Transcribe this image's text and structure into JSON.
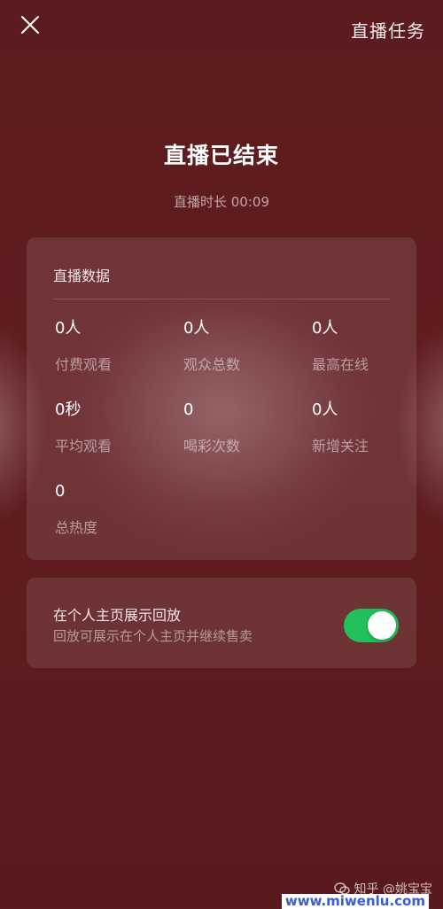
{
  "header": {
    "task_label": "直播任务"
  },
  "summary": {
    "title": "直播已结束",
    "duration": "直播时长 00:09"
  },
  "stats": {
    "title": "直播数据",
    "items": [
      {
        "value": "0人",
        "label": "付费观看"
      },
      {
        "value": "0人",
        "label": "观众总数"
      },
      {
        "value": "0人",
        "label": "最高在线"
      },
      {
        "value": "0秒",
        "label": "平均观看"
      },
      {
        "value": "0",
        "label": "喝彩次数"
      },
      {
        "value": "0人",
        "label": "新增关注"
      },
      {
        "value": "0",
        "label": "总热度"
      }
    ]
  },
  "replay": {
    "title": "在个人主页展示回放",
    "subtitle": "回放可展示在个人主页并继续售卖",
    "enabled": true
  },
  "colors": {
    "background": "#5c1b1e",
    "toggle_on": "#21c05a"
  },
  "watermark": {
    "text": "知乎 @姚宝宝",
    "site": "www.miwenlu.com"
  }
}
